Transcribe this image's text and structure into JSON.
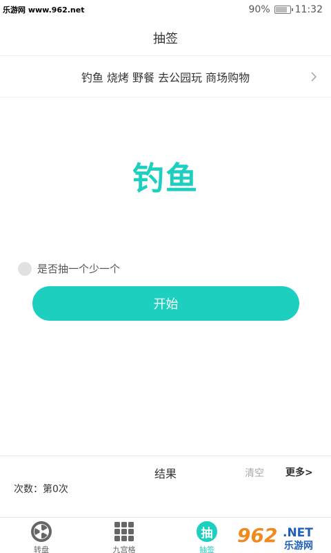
{
  "status_bar": {
    "watermark": "乐游网 www.962.net",
    "battery": "90%",
    "battery_level": 0.9,
    "time": "11:32"
  },
  "header": {
    "title": "抽签"
  },
  "options": {
    "text": "钓鱼 烧烤 野餐 去公园玩 商场购物"
  },
  "result": {
    "word": "钓鱼"
  },
  "toggle": {
    "label": "是否抽一个少一个",
    "checked": false
  },
  "start_button": {
    "label": "开始"
  },
  "results": {
    "title": "结果",
    "clear_label": "清空",
    "more_label": "更多>",
    "count_text": "次数：第0次"
  },
  "tabs": [
    {
      "label": "转盘",
      "icon": "wheel-icon",
      "active": false
    },
    {
      "label": "九宫格",
      "icon": "grid-icon",
      "active": false
    },
    {
      "label": "抽签",
      "icon": "draw-icon",
      "glyph": "抽",
      "active": true
    }
  ],
  "logo": {
    "number": "962",
    "suffix": ".NET",
    "name": "乐游网"
  },
  "colors": {
    "accent": "#1ccfbf",
    "muted": "#aaaaaa",
    "logo_orange": "#f08a1e",
    "logo_blue": "#1f5fb8"
  }
}
